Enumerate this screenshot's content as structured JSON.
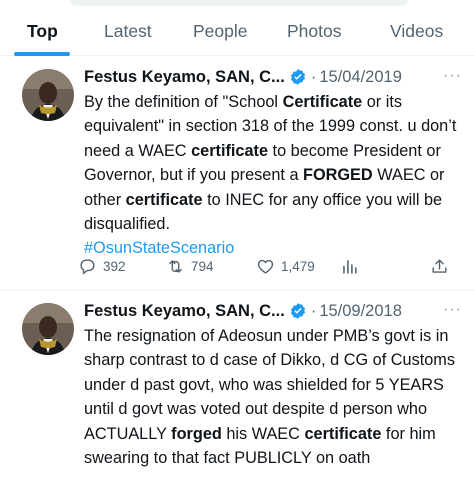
{
  "tabs": [
    "Top",
    "Latest",
    "People",
    "Photos",
    "Videos"
  ],
  "tweets": [
    {
      "name": "Festus Keyamo, SAN, C...",
      "date": "15/04/2019",
      "hashtag": "#OsunStateScenario",
      "counts": {
        "replies": "392",
        "retweets": "794",
        "likes": "1,479"
      }
    },
    {
      "name": "Festus Keyamo, SAN, C...",
      "date": "15/09/2018"
    }
  ],
  "colors": {
    "accent": "#1d9bf0",
    "muted": "#536471",
    "text": "#0f1419"
  },
  "icons": [
    "reply-icon",
    "retweet-icon",
    "like-icon",
    "views-icon",
    "share-icon",
    "verified-badge-icon",
    "more-icon"
  ]
}
